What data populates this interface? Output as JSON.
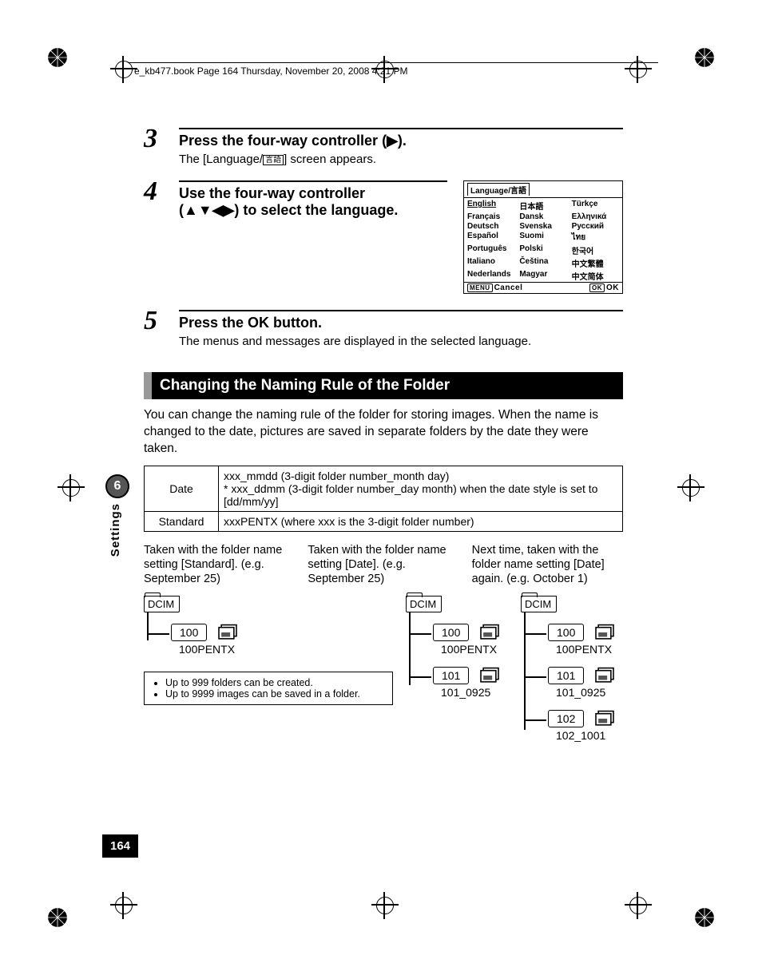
{
  "header": "e_kb477.book  Page 164  Thursday, November 20, 2008  4:21 PM",
  "steps": {
    "s3": {
      "num": "3",
      "title_pre": "Press the four-way controller (",
      "title_post": ").",
      "desc_pre": "The [Language/",
      "desc_post": "] screen appears.",
      "lang_glyph": "言語"
    },
    "s4": {
      "num": "4",
      "title_l1": "Use the four-way controller",
      "title_l2_pre": "(",
      "title_l2_post": ") to select the language."
    },
    "s5": {
      "num": "5",
      "title_pre": "Press the ",
      "title_btn": "OK",
      "title_post": " button.",
      "desc": "The menus and messages are displayed in the selected language."
    }
  },
  "lang_panel": {
    "title": "Language/言語",
    "columns": [
      [
        "English",
        "Français",
        "Deutsch",
        "Español",
        "Português",
        "Italiano",
        "Nederlands"
      ],
      [
        "日本語",
        "Dansk",
        "Svenska",
        "Suomi",
        "Polski",
        "Čeština",
        "Magyar"
      ],
      [
        "Türkçe",
        "Ελληνικά",
        "Русский",
        "ไทย",
        "한국어",
        "中文繁體",
        "中文简体"
      ]
    ],
    "footer_left_btn": "MENU",
    "footer_left": "Cancel",
    "footer_right_btn": "OK",
    "footer_right": "OK"
  },
  "section_title": "Changing the Naming Rule of the Folder",
  "intro": "You can change the naming rule of the folder for storing images. When the name is changed to the date, pictures are saved in separate folders by the date they were taken.",
  "table": {
    "date_label": "Date",
    "date_line1": "xxx_mmdd (3-digit folder number_month day)",
    "date_line2": "* xxx_ddmm (3-digit folder number_day month) when the date style is set to [dd/mm/yy]",
    "std_label": "Standard",
    "std_val": "xxxPENTX (where xxx is the 3-digit folder number)"
  },
  "examples": {
    "c1": "Taken with the folder name setting [Standard]. (e.g. September 25)",
    "c2": "Taken with the folder name setting [Date]. (e.g. September 25)",
    "c3": "Next time, taken with the folder name setting [Date] again. (e.g. October 1)"
  },
  "trees": {
    "dcim": "DCIM",
    "f1": {
      "nums": [
        "100"
      ],
      "labels": [
        "100PENTX"
      ]
    },
    "f2": {
      "nums": [
        "100",
        "101"
      ],
      "labels": [
        "100PENTX",
        "101_0925"
      ]
    },
    "f3": {
      "nums": [
        "100",
        "101",
        "102"
      ],
      "labels": [
        "100PENTX",
        "101_0925",
        "102_1001"
      ]
    }
  },
  "notes": {
    "n1": "Up to 999 folders can be created.",
    "n2": "Up to 9999 images can be saved in a folder."
  },
  "side": {
    "chapter": "6",
    "label": "Settings"
  },
  "page_number": "164"
}
